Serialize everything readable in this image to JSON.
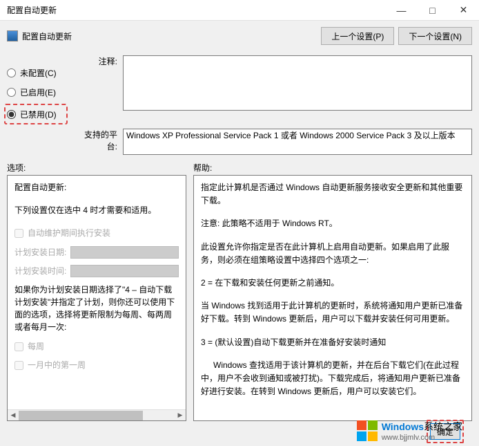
{
  "titlebar": {
    "title": "配置自动更新",
    "minimize": "—",
    "maximize": "□",
    "close": "✕"
  },
  "toolbar": {
    "title": "配置自动更新",
    "prev_btn": "上一个设置(P)",
    "next_btn": "下一个设置(N)"
  },
  "radios": {
    "not_configured": "未配置(C)",
    "enabled": "已启用(E)",
    "disabled": "已禁用(D)"
  },
  "labels": {
    "comment": "注释:",
    "platform": "支持的平台:",
    "options": "选项:",
    "help": "帮助:"
  },
  "platform_text": "Windows XP Professional Service Pack 1 或者 Windows 2000 Service Pack 3 及以上版本",
  "options": {
    "title": "配置自动更新:",
    "note": "下列设置仅在选中 4 时才需要和适用。",
    "checkbox_auto_maintain": "自动维护期间执行安装",
    "plan_date": "计划安装日期:",
    "plan_time": "计划安装时间:",
    "para_if": "如果你为计划安装日期选择了\"4 – 自动下载计划安装\"并指定了计划，则你还可以使用下面的选项，选择将更新限制为每周、每两周或者每月一次:",
    "chk_weekly": "每周",
    "chk_first_week": "一月中的第一周"
  },
  "help": {
    "p1": "指定此计算机是否通过 Windows 自动更新服务接收安全更新和其他重要下载。",
    "p2": "注意: 此策略不适用于 Windows RT。",
    "p3": "此设置允许你指定是否在此计算机上启用自动更新。如果启用了此服务，则必须在组策略设置中选择四个选项之一:",
    "p4": "2 = 在下载和安装任何更新之前通知。",
    "p5": "当 Windows 找到适用于此计算机的更新时，系统将通知用户更新已准备好下载。转到 Windows 更新后，用户可以下载并安装任何可用更新。",
    "p6": "3 = (默认设置)自动下载更新并在准备好安装时通知",
    "p7": "Windows 查找适用于该计算机的更新，并在后台下载它们(在此过程中，用户不会收到通知或被打扰)。下载完成后，将通知用户更新已准备好进行安装。在转到 Windows 更新后，用户可以安装它们。"
  },
  "footer": {
    "ok": "确定"
  },
  "watermark": {
    "name_blue": "Windows",
    "name_suffix": "系统之家",
    "url": "www.bjjmlv.com"
  }
}
